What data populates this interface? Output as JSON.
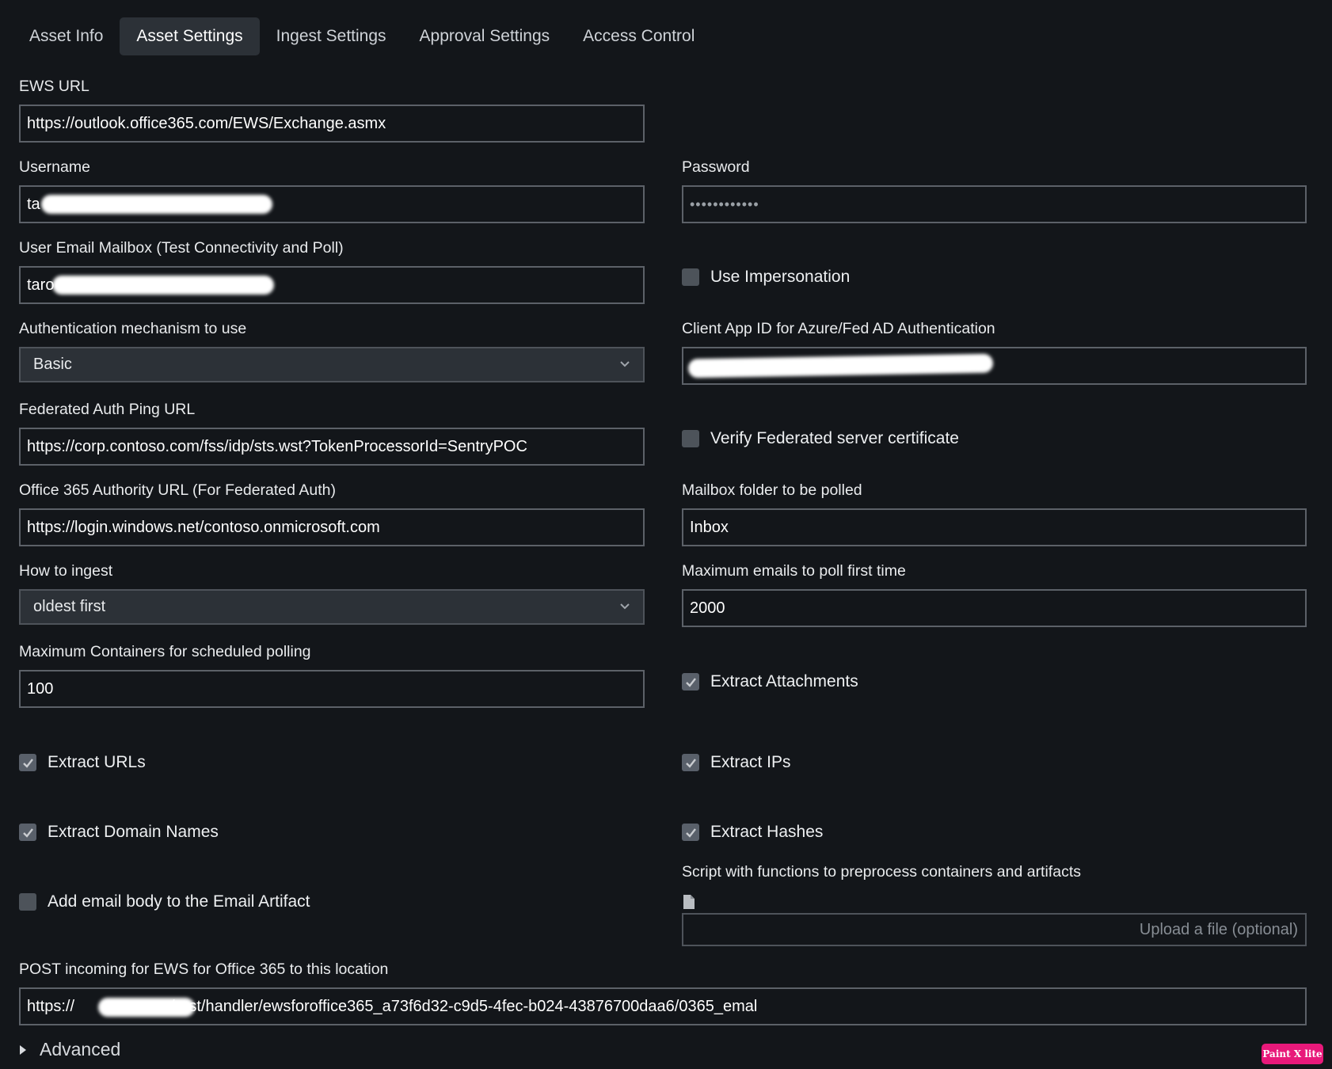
{
  "tabs": [
    "Asset Info",
    "Asset Settings",
    "Ingest Settings",
    "Approval Settings",
    "Access Control"
  ],
  "fields": {
    "ews_url": {
      "label": "EWS URL",
      "value": "https://outlook.office365.com/EWS/Exchange.asmx"
    },
    "username": {
      "label": "Username",
      "value": "ta"
    },
    "password": {
      "label": "Password",
      "value": "••••••••••••"
    },
    "mailbox": {
      "label": "User Email Mailbox (Test Connectivity and Poll)",
      "value": "taro"
    },
    "auth_mechanism": {
      "label": "Authentication mechanism to use",
      "value": "Basic"
    },
    "client_app_id": {
      "label": "Client App ID for Azure/Fed AD Authentication",
      "value": ""
    },
    "fed_ping_url": {
      "label": "Federated Auth Ping URL",
      "value": "https://corp.contoso.com/fss/idp/sts.wst?TokenProcessorId=SentryPOC"
    },
    "o365_authority": {
      "label": "Office 365 Authority URL (For Federated Auth)",
      "value": "https://login.windows.net/contoso.onmicrosoft.com"
    },
    "mailbox_folder": {
      "label": "Mailbox folder to be polled",
      "value": "Inbox"
    },
    "how_to_ingest": {
      "label": "How to ingest",
      "value": "oldest first"
    },
    "max_emails": {
      "label": "Maximum emails to poll first time",
      "value": "2000"
    },
    "max_containers": {
      "label": "Maximum Containers for scheduled polling",
      "value": "100"
    },
    "script": {
      "label": "Script with functions to preprocess containers and artifacts",
      "placeholder": "Upload a file (optional)"
    },
    "post_location": {
      "label": "POST incoming for EWS for Office 365 to this location",
      "value_prefix": "https://",
      "value_suffix": "/rest/handler/ewsforoffice365_a73f6d32-c9d5-4fec-b024-43876700daa6/0365_emal"
    }
  },
  "checkboxes": {
    "use_impersonation": {
      "label": "Use Impersonation",
      "checked": false
    },
    "verify_fed_cert": {
      "label": "Verify Federated server certificate",
      "checked": false
    },
    "extract_attachments": {
      "label": "Extract Attachments",
      "checked": true
    },
    "extract_urls": {
      "label": "Extract URLs",
      "checked": true
    },
    "extract_ips": {
      "label": "Extract IPs",
      "checked": true
    },
    "extract_domains": {
      "label": "Extract Domain Names",
      "checked": true
    },
    "extract_hashes": {
      "label": "Extract Hashes",
      "checked": true
    },
    "add_email_body": {
      "label": "Add email body to the Email Artifact",
      "checked": false
    }
  },
  "advanced": {
    "label": "Advanced"
  },
  "watermark": "Paint X lite"
}
